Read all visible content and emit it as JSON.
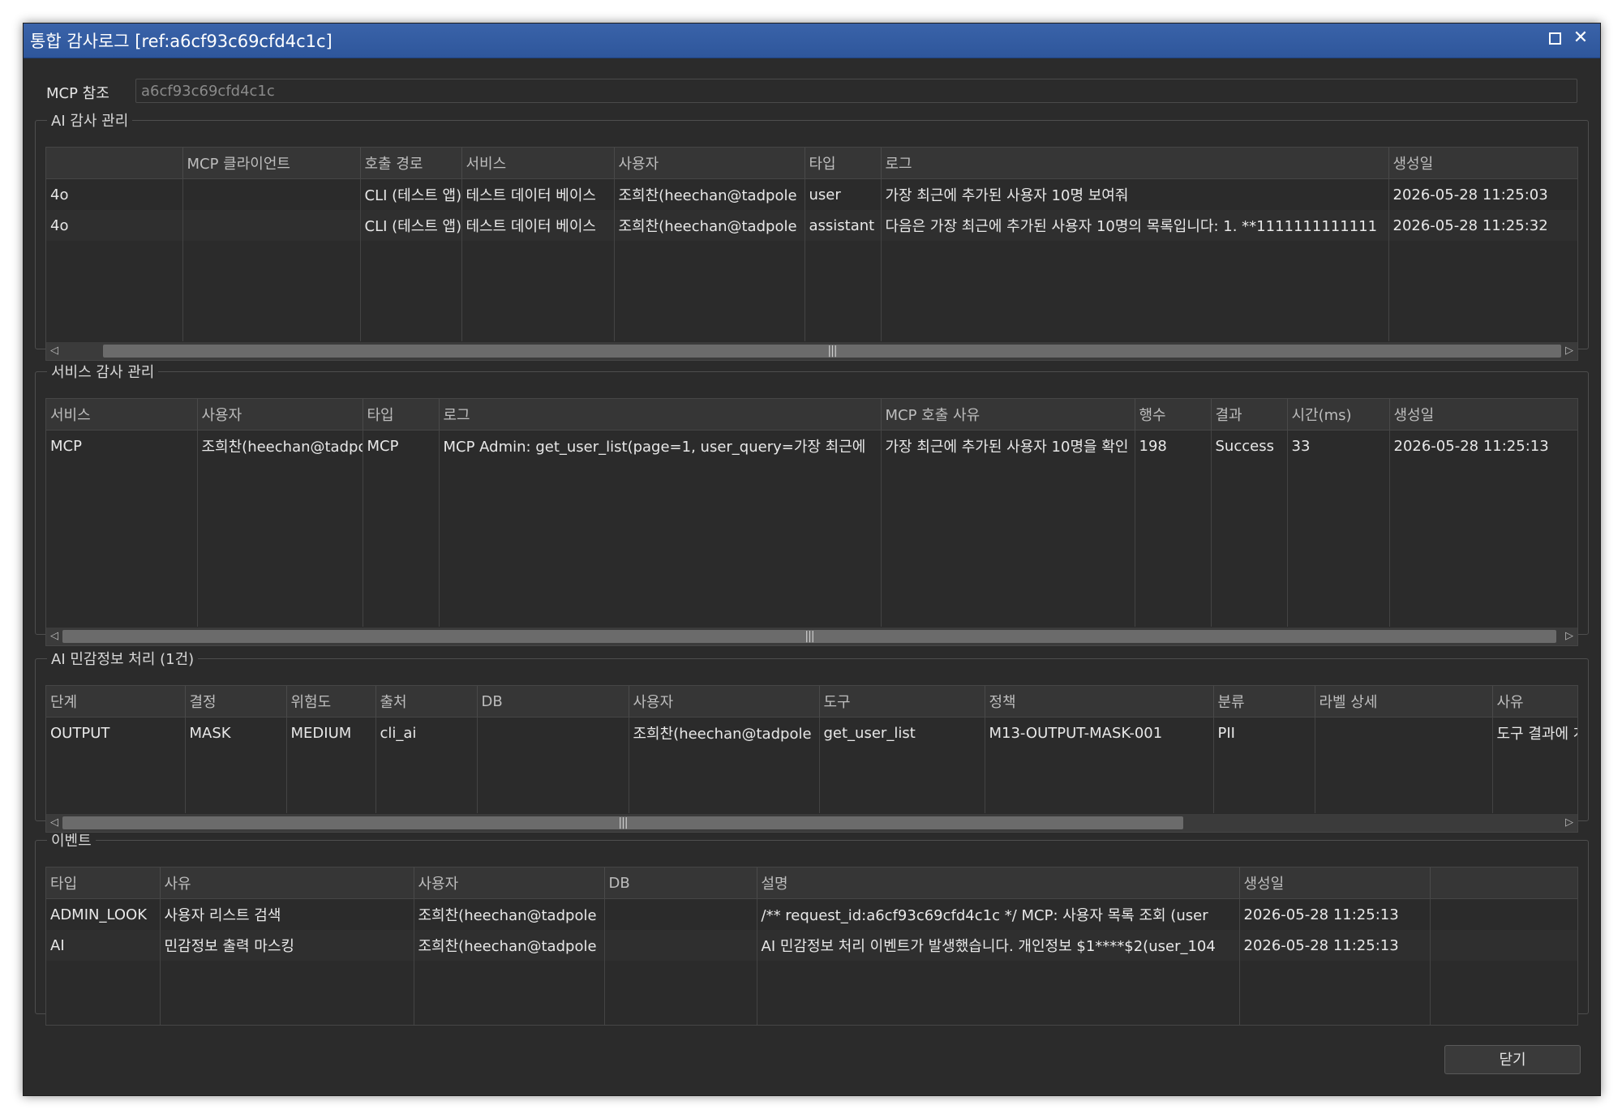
{
  "window": {
    "title": "통합 감사로그 [ref:a6cf93c69cfd4c1c]",
    "maximize_icon": "maximize-icon",
    "close_icon": "✕"
  },
  "ref": {
    "label": "MCP 참조",
    "value": "a6cf93c69cfd4c1c"
  },
  "ai_audit": {
    "legend": "AI 감사 관리",
    "headers": [
      "",
      "MCP 클라이언트",
      "호출 경로",
      "서비스",
      "사용자",
      "타입",
      "로그",
      "생성일"
    ],
    "rows": [
      [
        "4o",
        "",
        "CLI (테스트 앱)",
        "테스트 데이터 베이스",
        "조희찬(heechan@tadpole",
        "user",
        "가장 최근에 추가된 사용자 10명 보여줘",
        "2026-05-28 11:25:03"
      ],
      [
        "4o",
        "",
        "CLI (테스트 앱)",
        "테스트 데이터 베이스",
        "조희찬(heechan@tadpole",
        "assistant",
        "다음은 가장 최근에 추가된 사용자 10명의 목록입니다:  1. **1111111111111",
        "2026-05-28 11:25:32"
      ]
    ]
  },
  "service_audit": {
    "legend": "서비스 감사 관리",
    "headers": [
      "서비스",
      "사용자",
      "타입",
      "로그",
      "MCP 호출 사유",
      "행수",
      "결과",
      "시간(ms)",
      "생성일"
    ],
    "rows": [
      [
        "MCP",
        "조희찬(heechan@tadpole",
        "MCP",
        "MCP Admin: get_user_list(page=1, user_query=가장 최근에",
        "가장 최근에 추가된 사용자 10명을 확인",
        "198",
        "Success",
        "33",
        "2026-05-28 11:25:13"
      ]
    ]
  },
  "pii": {
    "legend": "AI 민감정보 처리 (1건)",
    "headers": [
      "단계",
      "결정",
      "위험도",
      "출처",
      "DB",
      "사용자",
      "도구",
      "정책",
      "분류",
      "라벨 상세",
      "사유"
    ],
    "rows": [
      [
        "OUTPUT",
        "MASK",
        "MEDIUM",
        "cli_ai",
        "",
        "조희찬(heechan@tadpole",
        "get_user_list",
        "M13-OUTPUT-MASK-001",
        "PII",
        "",
        "도구 결과에 개"
      ]
    ]
  },
  "events": {
    "legend": "이벤트",
    "headers": [
      "타입",
      "사유",
      "사용자",
      "DB",
      "설명",
      "생성일",
      ""
    ],
    "rows": [
      [
        "ADMIN_LOOK",
        "사용자 리스트 검색",
        "조희찬(heechan@tadpole",
        "",
        "/** request_id:a6cf93c69cfd4c1c */ MCP: 사용자 목록 조회 (user",
        "2026-05-28 11:25:13",
        ""
      ],
      [
        "AI",
        "민감정보 출력 마스킹",
        "조희찬(heechan@tadpole",
        "",
        "AI 민감정보 처리 이벤트가 발생했습니다. 개인정보 $1****$2(user_104",
        "2026-05-28 11:25:13",
        ""
      ]
    ]
  },
  "scroll_positions": {
    "ai_audit": 0.0,
    "service_audit": 0.0,
    "pii": 0.0
  },
  "buttons": {
    "close": "닫기"
  },
  "colors": {
    "titlebar": "#2e569b",
    "background": "#2b2b2b",
    "header": "#363636"
  }
}
